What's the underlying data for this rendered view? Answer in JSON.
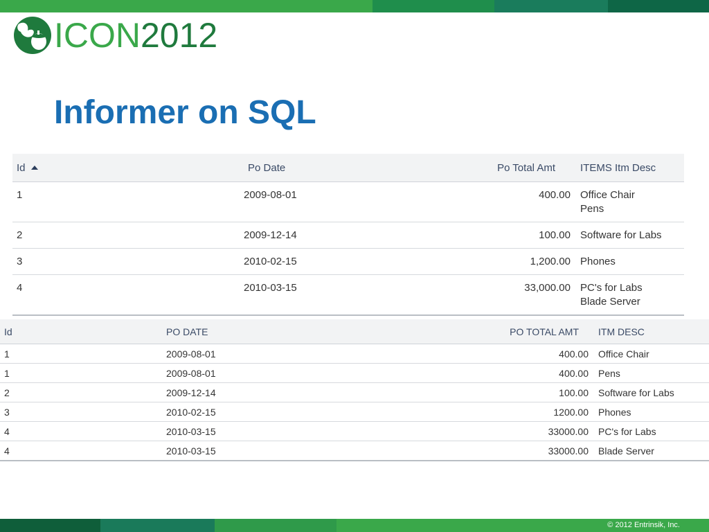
{
  "header": {
    "logo_text_primary": "ICON",
    "logo_text_secondary": "2012",
    "logo_icon": "acorn-leaf-icon",
    "top_bar_colors": [
      "#3aa84a",
      "#1e8a4a",
      "#1a7a5a",
      "#0f6a4a"
    ]
  },
  "slide": {
    "title": "Informer on SQL"
  },
  "table1": {
    "columns": [
      "Id",
      "Po Date",
      "Po Total Amt",
      "ITEMS Itm Desc"
    ],
    "sort_icon": "sort-ascending-icon",
    "rows": [
      {
        "id": "1",
        "date": "2009-08-01",
        "amount": "400.00",
        "items": [
          "Office Chair",
          "Pens"
        ]
      },
      {
        "id": "2",
        "date": "2009-12-14",
        "amount": "100.00",
        "items": [
          "Software for Labs"
        ]
      },
      {
        "id": "3",
        "date": "2010-02-15",
        "amount": "1,200.00",
        "items": [
          "Phones"
        ]
      },
      {
        "id": "4",
        "date": "2010-03-15",
        "amount": "33,000.00",
        "items": [
          "PC's for Labs",
          "Blade Server"
        ]
      }
    ]
  },
  "table2": {
    "columns": [
      "Id",
      "PO DATE",
      "PO TOTAL AMT",
      "ITM DESC"
    ],
    "rows": [
      {
        "id": "1",
        "date": "2009-08-01",
        "amount": "400.00",
        "desc": "Office Chair"
      },
      {
        "id": "1",
        "date": "2009-08-01",
        "amount": "400.00",
        "desc": "Pens"
      },
      {
        "id": "2",
        "date": "2009-12-14",
        "amount": "100.00",
        "desc": "Software for Labs"
      },
      {
        "id": "3",
        "date": "2010-02-15",
        "amount": "1200.00",
        "desc": "Phones"
      },
      {
        "id": "4",
        "date": "2010-03-15",
        "amount": "33000.00",
        "desc": "PC's for Labs"
      },
      {
        "id": "4",
        "date": "2010-03-15",
        "amount": "33000.00",
        "desc": "Blade Server"
      }
    ]
  },
  "footer": {
    "copyright": "© 2012 Entrinsik, Inc.",
    "bar_colors": [
      "#0f5e3a",
      "#1a7a5a",
      "#3aa84a",
      "#3aa84a"
    ]
  }
}
